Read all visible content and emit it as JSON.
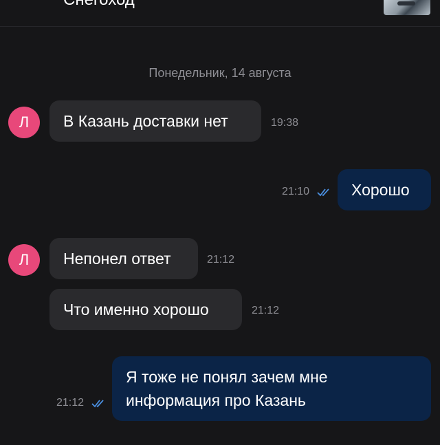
{
  "header": {
    "title": "Снегоход"
  },
  "date_separator": "Понедельник, 14 августа",
  "messages": [
    {
      "side": "in",
      "avatar": "Л",
      "text": "В Казань доставки нет",
      "time": "19:38"
    },
    {
      "side": "out",
      "text": "Хорошо",
      "time": "21:10",
      "status": "read"
    },
    {
      "side": "in",
      "avatar": "Л",
      "text": "Непонел ответ",
      "time": "21:12"
    },
    {
      "side": "in",
      "text": "Что именно хорошо",
      "time": "21:12"
    },
    {
      "side": "out",
      "text": "Я тоже не понял зачем мне информация про Казань",
      "time": "21:12",
      "status": "read"
    }
  ],
  "colors": {
    "background": "#161618",
    "incoming_bubble": "#2a2a2d",
    "outgoing_bubble": "#0b2447",
    "avatar": "#e8487a",
    "read_check": "#4a8fe0",
    "muted_text": "#8d8d93"
  },
  "icons": {
    "read_status": "double-check-icon",
    "header_thumbnail": "snowmobile-thumbnail"
  }
}
